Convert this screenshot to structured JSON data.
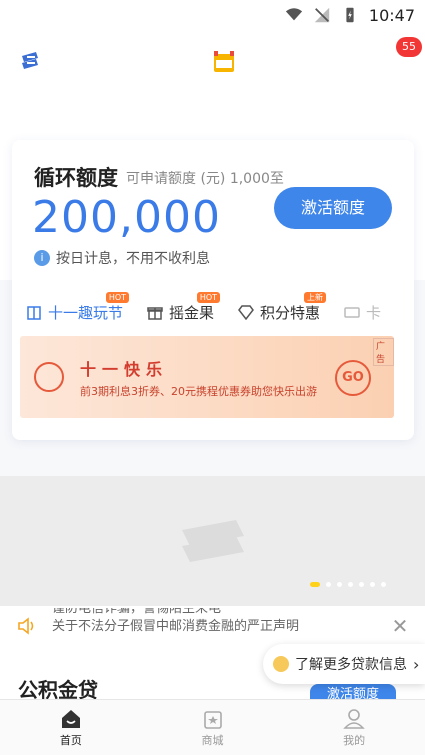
{
  "status_bar": {
    "time": "10:47"
  },
  "header": {
    "badge_count": "55"
  },
  "credit_card": {
    "title": "循环额度",
    "subtitle": "可申请额度 (元) 1,000至",
    "amount": "200,000",
    "info_text": "按日计息，不用不收利息",
    "activate_label": "激活额度"
  },
  "tabs": [
    {
      "label": "十一趣玩节",
      "badge": "HOT",
      "icon": "gift-box-icon"
    },
    {
      "label": "摇金果",
      "badge": "HOT",
      "icon": "gift-icon"
    },
    {
      "label": "积分特惠",
      "badge": "上新",
      "icon": "diamond-icon"
    },
    {
      "label": "卡",
      "badge": "",
      "icon": "ticket-icon"
    }
  ],
  "promo": {
    "title": "十一快乐",
    "desc": "前3期利息3折券、20元携程优惠券助您快乐出游",
    "go_label": "GO",
    "ad_label": "广告"
  },
  "notice": {
    "line1": "谨防电信诈骗，警惕陌生来电",
    "line2": "关于不法分子假冒中邮消费金融的严正声明"
  },
  "section": {
    "title": "公积金贷",
    "button_label": "激活额度"
  },
  "learn_more": {
    "label": "了解更多贷款信息"
  },
  "bottom_nav": [
    {
      "label": "首页",
      "icon": "home-icon"
    },
    {
      "label": "商城",
      "icon": "shop-icon"
    },
    {
      "label": "我的",
      "icon": "profile-icon"
    }
  ],
  "colors": {
    "accent": "#3a7be8",
    "badge": "#f23636",
    "promo": "#d33d2f",
    "hot": "#ff7a2f",
    "indicator": "#ffd21a"
  }
}
